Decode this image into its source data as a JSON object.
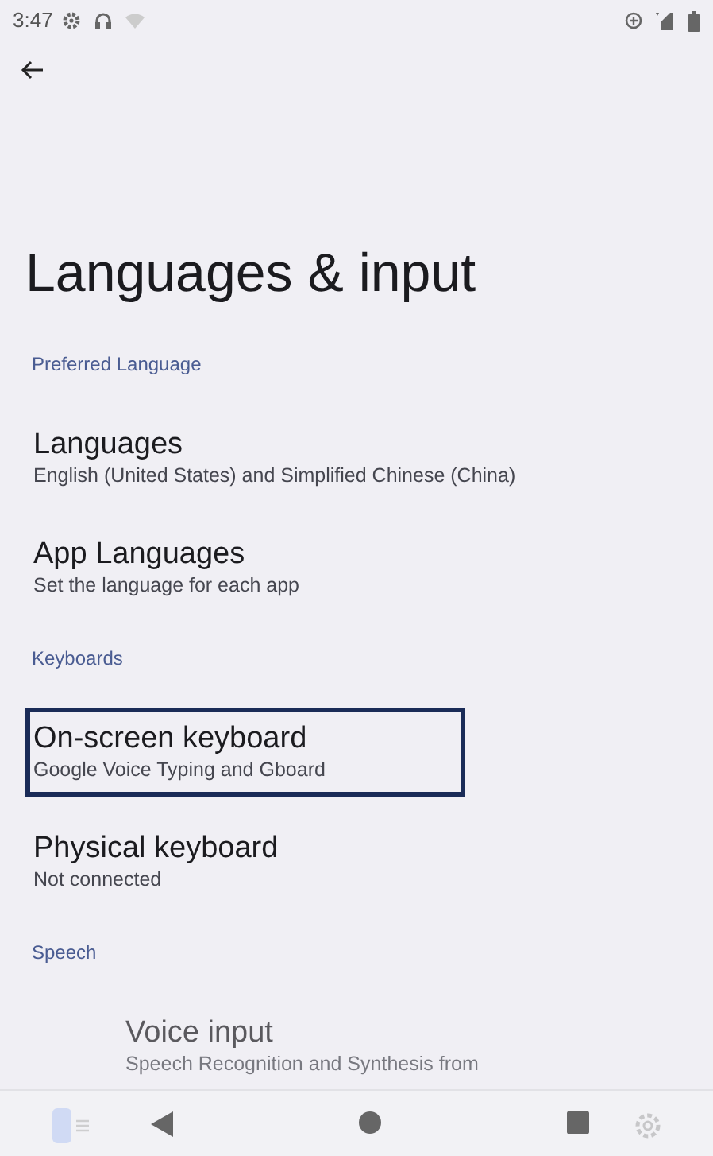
{
  "status_bar": {
    "time": "3:47"
  },
  "title": "Languages & input",
  "sections": [
    {
      "header": "Preferred Language",
      "items": [
        {
          "title": "Languages",
          "subtitle": "English (United States) and Simplified Chinese (China)",
          "selected": false
        },
        {
          "title": "App Languages",
          "subtitle": "Set the language for each app",
          "selected": false
        }
      ]
    },
    {
      "header": "Keyboards",
      "items": [
        {
          "title": "On-screen keyboard",
          "subtitle": "Google Voice Typing and Gboard",
          "selected": true
        },
        {
          "title": "Physical keyboard",
          "subtitle": "Not connected",
          "selected": false
        }
      ]
    },
    {
      "header": "Speech",
      "items": [
        {
          "title": "Voice input",
          "subtitle": "Speech Recognition and Synthesis from",
          "selected": false
        }
      ]
    }
  ]
}
